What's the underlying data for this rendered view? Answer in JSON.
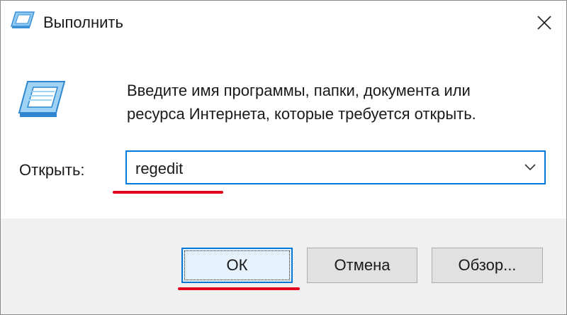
{
  "window": {
    "title": "Выполнить",
    "close_icon": "close-icon",
    "app_icon": "run-dialog-icon"
  },
  "content": {
    "description_line1": "Введите имя программы, папки, документа или",
    "description_line2": "ресурса Интернета, которые требуется открыть.",
    "open_label": "Открыть:",
    "open_value": "regedit"
  },
  "buttons": {
    "ok": "ОК",
    "cancel": "Отмена",
    "browse": "Обзор..."
  },
  "colors": {
    "accent": "#0078d7",
    "highlight_underline": "#e4001b",
    "footer_bg": "#f0f0f0"
  }
}
